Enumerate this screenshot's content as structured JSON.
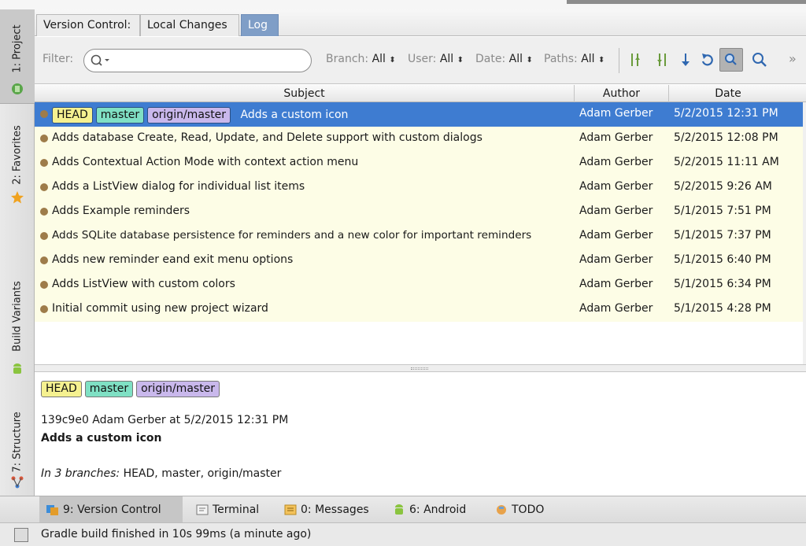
{
  "left_stripe": {
    "project": "1: Project",
    "favorites": "2: Favorites",
    "build_variants": "Build Variants",
    "structure": "7: Structure"
  },
  "tabs": {
    "version_control": "Version Control:",
    "local_changes": "Local Changes",
    "log": "Log"
  },
  "filter": {
    "label": "Filter:",
    "value": "",
    "branch_label": "Branch:",
    "branch_value": "All",
    "user_label": "User:",
    "user_value": "All",
    "date_label": "Date:",
    "date_value": "All",
    "paths_label": "Paths:",
    "paths_value": "All",
    "overflow": "»"
  },
  "table": {
    "columns": {
      "subject": "Subject",
      "author": "Author",
      "date": "Date"
    },
    "refs": {
      "head": "HEAD",
      "master": "master",
      "origin": "origin/master"
    },
    "rows": [
      {
        "subject": "Adds a custom icon",
        "author": "Adam Gerber",
        "date": "5/2/2015 12:31 PM"
      },
      {
        "subject": "Adds database Create, Read, Update, and Delete support with custom dialogs",
        "author": "Adam Gerber",
        "date": "5/2/2015 12:08 PM"
      },
      {
        "subject": "Adds Contextual Action Mode with context action menu",
        "author": "Adam Gerber",
        "date": "5/2/2015 11:11 AM"
      },
      {
        "subject": "Adds a ListView dialog for individual list items",
        "author": "Adam Gerber",
        "date": "5/2/2015 9:26 AM"
      },
      {
        "subject": "Adds Example reminders",
        "author": "Adam Gerber",
        "date": "5/1/2015 7:51 PM"
      },
      {
        "subject": "Adds SQLite database persistence for reminders and a new color for important reminders",
        "author": "Adam Gerber",
        "date": "5/1/2015 7:37 PM"
      },
      {
        "subject": "Adds new reminder eand exit menu options",
        "author": "Adam Gerber",
        "date": "5/1/2015 6:40 PM"
      },
      {
        "subject": "Adds ListView with custom colors",
        "author": "Adam Gerber",
        "date": "5/1/2015 6:34 PM"
      },
      {
        "subject": "Initial commit using new project wizard",
        "author": "Adam Gerber",
        "date": "5/1/2015 4:28 PM"
      }
    ]
  },
  "details": {
    "meta": "139c9e0 Adam Gerber at 5/2/2015 12:31 PM",
    "message": "Adds a custom icon",
    "branches_label": "In 3 branches:",
    "branches_list": "HEAD, master, origin/master"
  },
  "bottom_tools": {
    "version_control": "9: Version Control",
    "terminal": "Terminal",
    "messages": "0: Messages",
    "android": "6: Android",
    "todo": "TODO"
  },
  "status": {
    "text": "Gradle build finished in 10s 99ms (a minute ago)"
  },
  "colors": {
    "selected_row": "#3e7cd1",
    "row_background": "#fdfde6",
    "graph": "#9e7c4a",
    "ref_head": "#f5f190",
    "ref_master": "#7fe0c4",
    "ref_origin": "#c9b8ec",
    "log_tab": "#7f9ec7"
  }
}
